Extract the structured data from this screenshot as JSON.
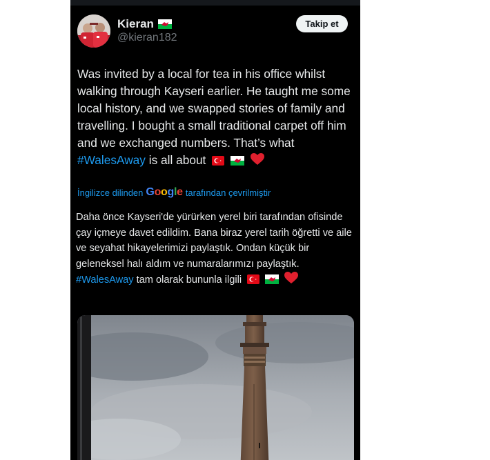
{
  "user": {
    "name": "Kieran",
    "handle": "@kieran182",
    "follow_label": "Takip et"
  },
  "tweet": {
    "text_before": "Was invited by a local for tea in his office whilst walking through Kayseri earlier. He taught me some local history, and we swapped stories of family and travelling. I bought a small traditional carpet off him and we exchanged numbers. That’s what ",
    "hashtag": "#WalesAway",
    "text_after": " is all about",
    "emojis": [
      "turkey-flag",
      "wales-flag",
      "red-heart"
    ]
  },
  "translation": {
    "prefix": "İngilizce dilinden",
    "google": "Google",
    "suffix": "tarafından çevrilmiştir",
    "text_before": "Daha önce Kayseri'de yürürken yerel biri tarafından ofisinde çay içmeye davet edildim. Bana biraz yerel tarih öğretti ve aile ve seyahat hikayelerimizi paylaştık. Ondan küçük bir geleneksel halı aldım ve numaralarımızı paylaştık. ",
    "hashtag": "#WalesAway",
    "text_after": " tam olarak bununla ilgili"
  },
  "media": {
    "subject": "minaret against cloudy sky"
  },
  "colors": {
    "background": "#000000",
    "text": "#e7e9ea",
    "muted": "#71767b",
    "link": "#1d9bf0",
    "follow_bg": "#eff3f4"
  }
}
